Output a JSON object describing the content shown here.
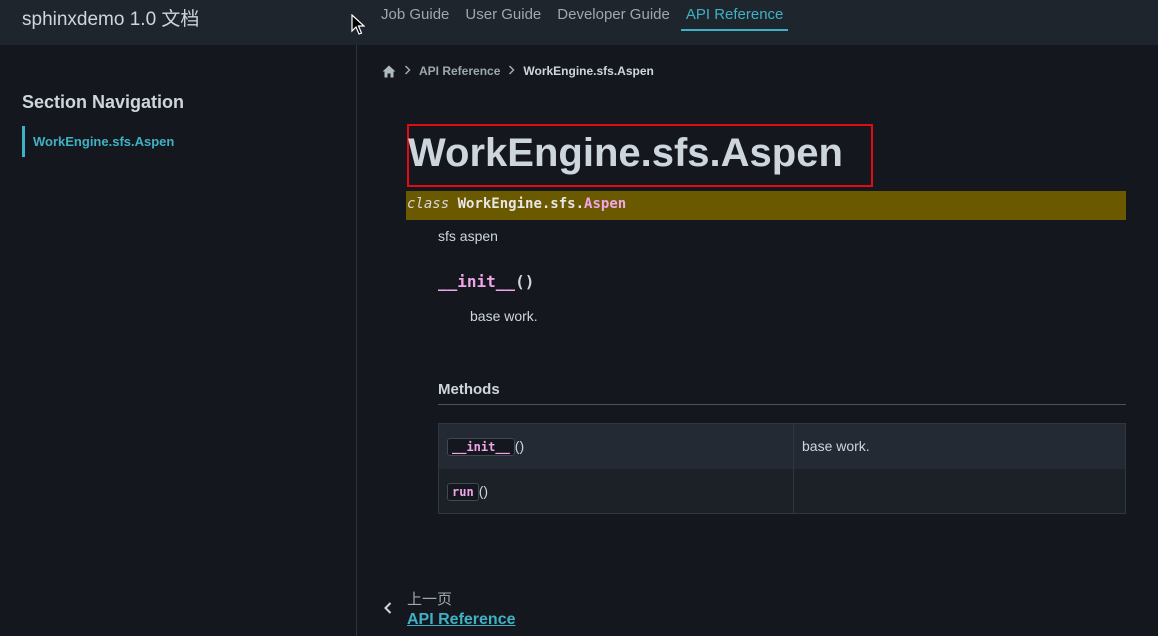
{
  "header": {
    "brand": "sphinxdemo 1.0 文档",
    "nav": [
      {
        "label": "Job Guide"
      },
      {
        "label": "User Guide"
      },
      {
        "label": "Developer Guide"
      },
      {
        "label": "API Reference",
        "active": true
      }
    ]
  },
  "sidebar": {
    "title": "Section Navigation",
    "items": [
      {
        "label": "WorkEngine.sfs.Aspen"
      }
    ]
  },
  "breadcrumb": {
    "home_icon": "home-icon",
    "items": [
      "API Reference",
      "WorkEngine.sfs.Aspen"
    ]
  },
  "page": {
    "title": "WorkEngine.sfs.Aspen",
    "signature": {
      "keyword": "class",
      "module": "WorkEngine.sfs.",
      "name": "Aspen"
    },
    "description": "sfs aspen",
    "method": {
      "name": "__init__",
      "parens": "()",
      "description": "base work."
    },
    "methods_heading": "Methods",
    "methods_table": [
      {
        "name": "__init__",
        "parens": "()",
        "description": "base work."
      },
      {
        "name": "run",
        "parens": "()",
        "description": ""
      }
    ]
  },
  "footer": {
    "prev_label": "上一页",
    "prev_link": "API Reference"
  },
  "colors": {
    "accent": "#3fb1c5",
    "signature_bg": "#6b5900",
    "highlight_box": "#e30b13"
  }
}
